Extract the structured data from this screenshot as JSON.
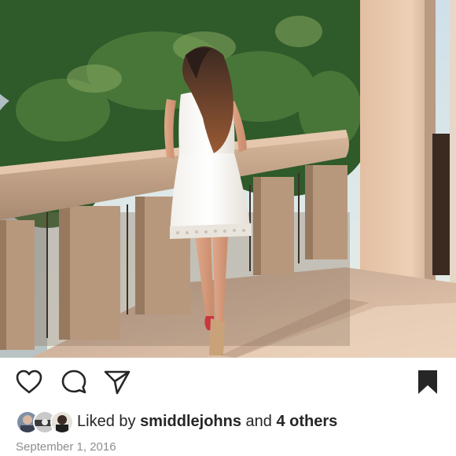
{
  "post": {
    "image_alt": "Woman in white dress standing at stone balcony overlooking trees",
    "liked": {
      "prefix": "Liked by",
      "user": "smiddlejohns",
      "conjunction": "and",
      "others": "4 others"
    },
    "date": "September 1, 2016"
  },
  "icons": {
    "like": "heart-outline-icon",
    "comment": "comment-bubble-icon",
    "share": "paper-plane-icon",
    "save": "bookmark-filled-icon"
  },
  "colors": {
    "text": "#262626",
    "muted": "#8e8e8e",
    "icon": "#262626"
  }
}
